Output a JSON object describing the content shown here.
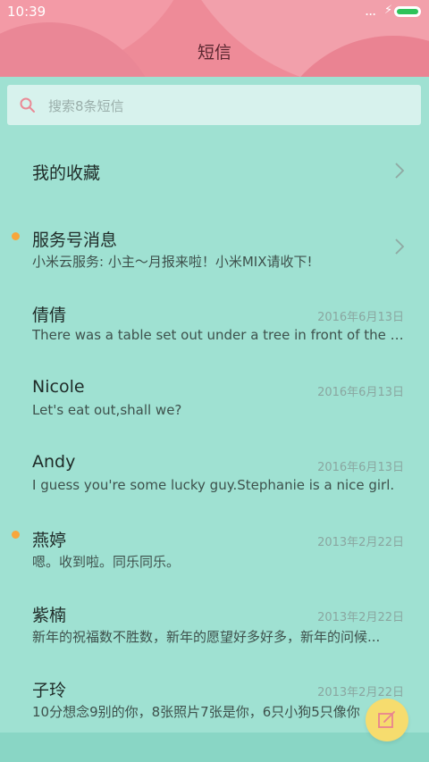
{
  "status_bar": {
    "time": "10:39",
    "dots": "...",
    "bolt": "⚡"
  },
  "header": {
    "title": "短信"
  },
  "search": {
    "placeholder": "搜索8条短信"
  },
  "favorites": {
    "label": "我的收藏"
  },
  "conversations": [
    {
      "name": "服务号消息",
      "preview": "小米云服务: 小主～月报来啦！小米MIX请收下!",
      "date": "",
      "unread": true
    },
    {
      "name": "倩倩",
      "preview": "There was a table set out under a tree in front of the ho...",
      "date": "2016年6月13日",
      "unread": false
    },
    {
      "name": "Nicole",
      "preview": "Let's eat out,shall we?",
      "date": "2016年6月13日",
      "unread": false
    },
    {
      "name": "Andy",
      "preview": "I guess you're some lucky guy.Stephanie is a nice girl.",
      "date": "2016年6月13日",
      "unread": false
    },
    {
      "name": "燕婷",
      "preview": "嗯。收到啦。同乐同乐。",
      "date": "2013年2月22日",
      "unread": true
    },
    {
      "name": "紫楠",
      "preview": "新年的祝福数不胜数，新年的愿望好多好多，新年的问候...",
      "date": "2013年2月22日",
      "unread": false
    },
    {
      "name": "子玲",
      "preview": "10分想念9别的你，8张照片7张是你，6只小狗5只像你",
      "date": "2013年2月22日",
      "unread": false
    }
  ],
  "colors": {
    "header": "#ee8b98",
    "background": "#9fe1d2",
    "unread_dot": "#f8a63b",
    "fab": "#f6dc6e"
  },
  "icons": {
    "search": "search-icon",
    "chevron": "chevron-right-icon",
    "compose": "compose-icon"
  }
}
